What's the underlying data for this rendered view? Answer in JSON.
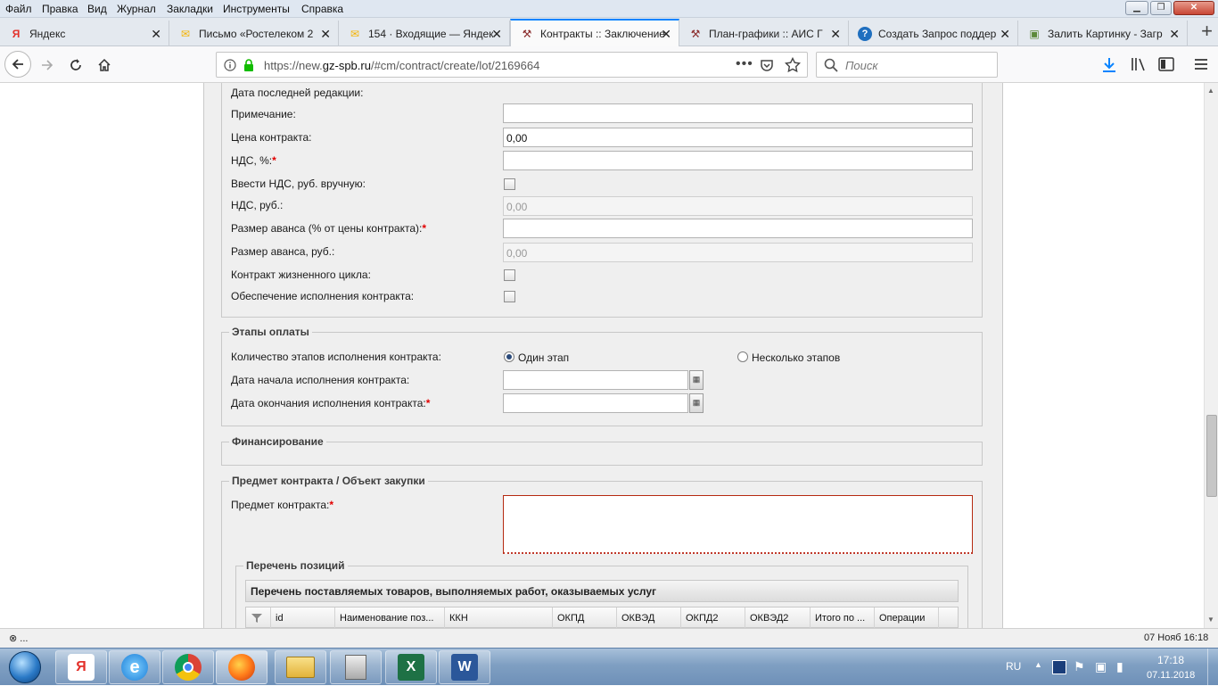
{
  "menu": [
    "Файл",
    "Правка",
    "Вид",
    "Журнал",
    "Закладки",
    "Инструменты",
    "Справка"
  ],
  "tabs": [
    {
      "label": "Яндекс",
      "icon": "yandex-icon",
      "icon_char": "Я",
      "icon_color": "#e3312b"
    },
    {
      "label": "Письмо «Ростелеком 2",
      "icon": "mail-icon",
      "icon_char": "✉",
      "icon_color": "#f5b301"
    },
    {
      "label": "154 · Входящие — Яндекс",
      "icon": "mail-icon",
      "icon_char": "✉",
      "icon_color": "#f5b301"
    },
    {
      "label": "Контракты :: Заключение",
      "icon": "gavel-icon",
      "icon_char": "⚒",
      "icon_color": "#8a2b2b"
    },
    {
      "label": "План-графики :: АИС Г",
      "icon": "gavel-icon",
      "icon_char": "⚒",
      "icon_color": "#8a2b2b"
    },
    {
      "label": "Создать Запрос поддер",
      "icon": "help-icon",
      "icon_char": "?",
      "icon_color": "#1f6fbf"
    },
    {
      "label": "Залить Картинку - Загр",
      "icon": "image-icon",
      "icon_char": "▣",
      "icon_color": "#5d8a3a"
    }
  ],
  "url": {
    "prefix": "https://new.",
    "domain": "gz-spb.ru",
    "path": "/#cm/contract/create/lot/2169664"
  },
  "search_placeholder": "Поиск",
  "form": {
    "last_edit_label": "Дата последней редакции:",
    "note_label": "Примечание:",
    "price_label": "Цена контракта:",
    "price_value": "0,00",
    "vat_label": "НДС, %:",
    "vat_manual_label": "Ввести НДС, руб. вручную:",
    "vat_rub_label": "НДС, руб.:",
    "vat_rub_value": "0,00",
    "advance_pct_label": "Размер аванса (% от цены контракта):",
    "advance_rub_label": "Размер аванса, руб.:",
    "advance_rub_value": "0,00",
    "lifecycle_label": "Контракт жизненного цикла:",
    "security_label": "Обеспечение исполнения контракта:",
    "required_mark": "*"
  },
  "payment": {
    "legend": "Этапы оплаты",
    "stages_label": "Количество этапов исполнения контракта:",
    "one_stage": "Один этап",
    "multi_stage": "Несколько этапов",
    "start_label": "Дата начала исполнения контракта:",
    "end_label": "Дата окончания исполнения контракта:"
  },
  "financing": {
    "legend": "Финансирование"
  },
  "subject": {
    "legend": "Предмет контракта / Объект закупки",
    "subject_label": "Предмет контракта:",
    "positions_legend": "Перечень позиций",
    "grid_title": "Перечень поставляемых товаров, выполняемых работ, оказываемых услуг",
    "columns": [
      "id",
      "Наименование поз...",
      "ККН",
      "ОКПД",
      "ОКВЭД",
      "ОКПД2",
      "ОКВЭД2",
      "Итого по ...",
      "Операции"
    ]
  },
  "status": {
    "left": "⊗ ...",
    "right": "07 Нояб 16:18"
  },
  "taskbar": {
    "lang": "RU",
    "time": "17:18",
    "date": "07.11.2018"
  }
}
